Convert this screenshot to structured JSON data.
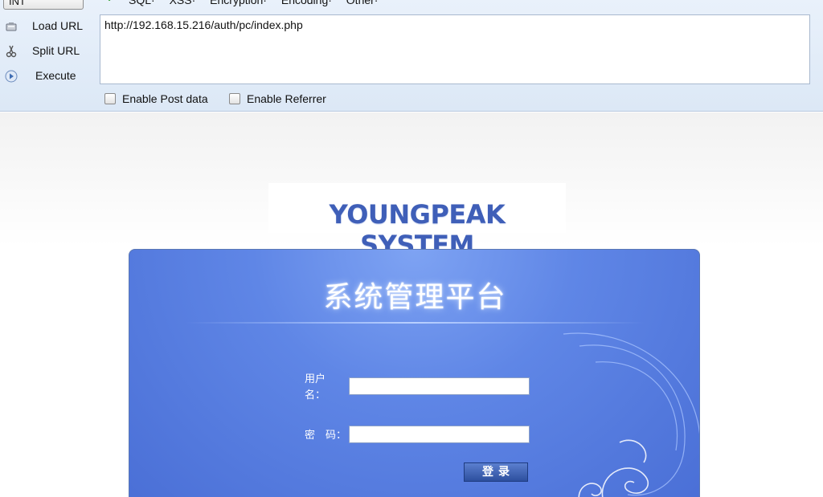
{
  "hackbar": {
    "select_value": "INT",
    "menu": [
      "SQL·",
      "XSS·",
      "Encryption·",
      "Encoding·",
      "Other·"
    ],
    "buttons": {
      "load": "Load URL",
      "split": "Split URL",
      "execute": "Execute"
    },
    "url": "http://192.168.15.216/auth/pc/index.php",
    "checkboxes": {
      "post": "Enable Post data",
      "referrer": "Enable Referrer"
    }
  },
  "page": {
    "logo": "YOUNGPEAK SYSTEM",
    "panel_title": "系统管理平台",
    "username_label": "用户名：",
    "password_label": "密　码：",
    "login_button": "登录"
  },
  "colors": {
    "accent": "#4a6fd6",
    "logo": "#3f5fb8",
    "check_green": "#2a9b2a"
  }
}
